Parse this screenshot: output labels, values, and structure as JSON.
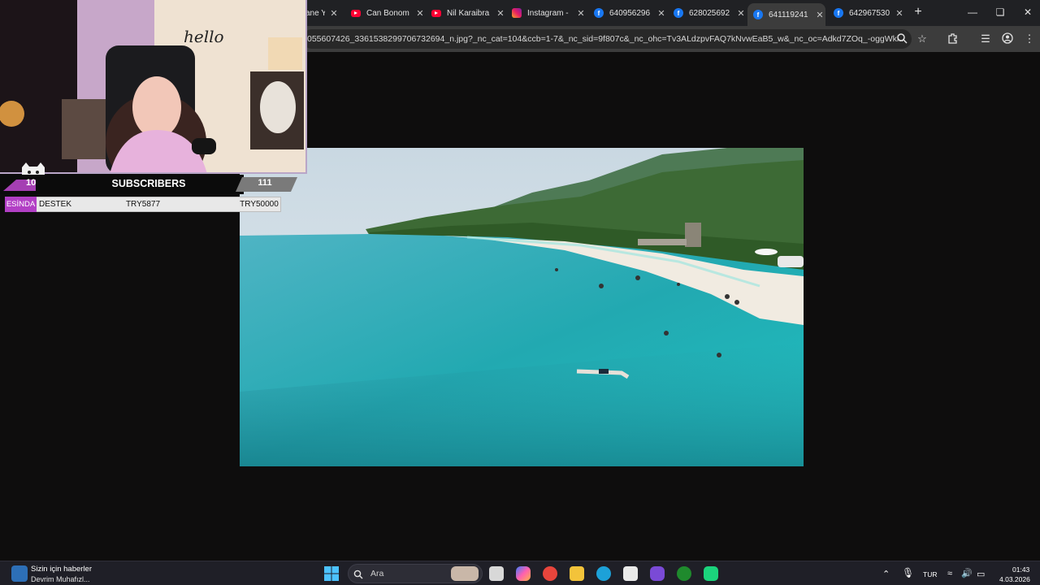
{
  "browser": {
    "tabs": [
      {
        "label": "ane Y",
        "favicon": "none",
        "active": false
      },
      {
        "label": "Can Bonom",
        "favicon": "youtube-icon",
        "active": false
      },
      {
        "label": "Nil Karaibra",
        "favicon": "youtube-icon",
        "active": false
      },
      {
        "label": "Instagram -",
        "favicon": "instagram-icon",
        "active": false
      },
      {
        "label": "640956296",
        "favicon": "facebook-icon",
        "active": false
      },
      {
        "label": "628025692",
        "favicon": "facebook-icon",
        "active": false
      },
      {
        "label": "641119241",
        "favicon": "facebook-icon",
        "active": true
      },
      {
        "label": "642967530",
        "favicon": "facebook-icon",
        "active": false
      }
    ],
    "close_glyph": "✕",
    "new_tab_glyph": "+",
    "url": "055607426_3361538299706732694_n.jpg?_nc_cat=104&ccb=1-7&_nc_sid=9f807c&_nc_ohc=Tv3ALdzpvFAQ7kNvwEaB5_w&_nc_oc=Adkd7ZOq_-oggWkl...",
    "accent_color": "#3c3c3c"
  },
  "overlay": {
    "hello_text": "hello",
    "subscribers_left": "10",
    "subscribers_title": "SUBSCRIBERS",
    "subscribers_right": "111",
    "donation_tag": "ESİNDA",
    "donation_label": "DESTEK",
    "donation_current": "TRY5877",
    "donation_goal": "TRY50000",
    "accent_color": "#b23fc5"
  },
  "taskbar": {
    "news_title": "Sizin için haberler",
    "news_subtitle": "Devrim Muhafızl...",
    "search_placeholder": "Ara",
    "language": "TUR",
    "time": "01:43",
    "date": "4.03.2026"
  }
}
